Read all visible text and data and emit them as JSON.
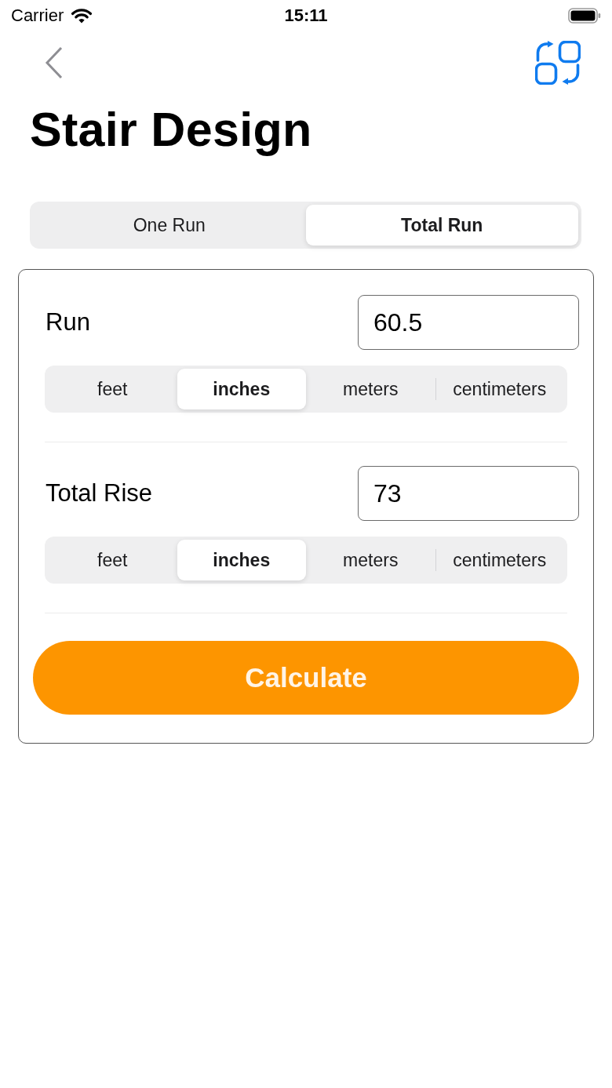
{
  "status_bar": {
    "carrier": "Carrier",
    "time": "15:11"
  },
  "page": {
    "title": "Stair Design"
  },
  "mode_tabs": [
    {
      "label": "One Run",
      "selected": false
    },
    {
      "label": "Total Run",
      "selected": true
    }
  ],
  "fields": [
    {
      "label": "Run",
      "value": "60.5",
      "units": [
        {
          "label": "feet",
          "selected": false
        },
        {
          "label": "inches",
          "selected": true
        },
        {
          "label": "meters",
          "selected": false
        },
        {
          "label": "centimeters",
          "selected": false
        }
      ]
    },
    {
      "label": "Total Rise",
      "value": "73",
      "units": [
        {
          "label": "feet",
          "selected": false
        },
        {
          "label": "inches",
          "selected": true
        },
        {
          "label": "meters",
          "selected": false
        },
        {
          "label": "centimeters",
          "selected": false
        }
      ]
    }
  ],
  "button": {
    "label": "Calculate"
  }
}
